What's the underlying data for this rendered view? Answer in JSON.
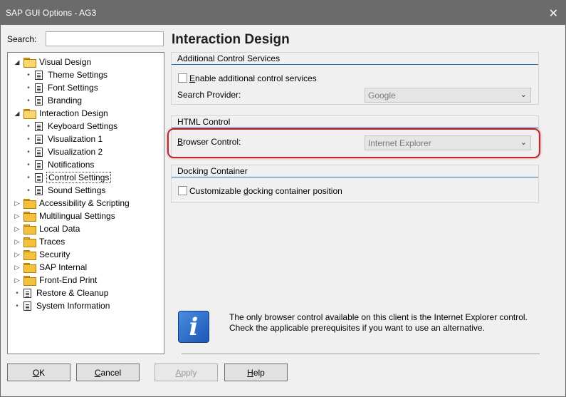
{
  "window": {
    "title": "SAP GUI Options - AG3"
  },
  "search": {
    "label": "Search:",
    "value": ""
  },
  "tree": [
    {
      "label": "Visual Design",
      "kind": "folder-open",
      "expander": "◢",
      "level": 0
    },
    {
      "label": "Theme Settings",
      "kind": "doc",
      "level": 1
    },
    {
      "label": "Font Settings",
      "kind": "doc",
      "level": 1
    },
    {
      "label": "Branding",
      "kind": "doc",
      "level": 1
    },
    {
      "label": "Interaction Design",
      "kind": "folder-open",
      "expander": "◢",
      "level": 0
    },
    {
      "label": "Keyboard Settings",
      "kind": "doc",
      "level": 1
    },
    {
      "label": "Visualization 1",
      "kind": "doc",
      "level": 1
    },
    {
      "label": "Visualization 2",
      "kind": "doc",
      "level": 1
    },
    {
      "label": "Notifications",
      "kind": "doc",
      "level": 1
    },
    {
      "label": "Control Settings",
      "kind": "doc",
      "level": 1,
      "selected": true
    },
    {
      "label": "Sound Settings",
      "kind": "doc",
      "level": 1
    },
    {
      "label": "Accessibility & Scripting",
      "kind": "folder",
      "expander": "▷",
      "level": 0
    },
    {
      "label": "Multilingual Settings",
      "kind": "folder",
      "expander": "▷",
      "level": 0
    },
    {
      "label": "Local Data",
      "kind": "folder",
      "expander": "▷",
      "level": 0
    },
    {
      "label": "Traces",
      "kind": "folder",
      "expander": "▷",
      "level": 0
    },
    {
      "label": "Security",
      "kind": "folder",
      "expander": "▷",
      "level": 0
    },
    {
      "label": "SAP Internal",
      "kind": "folder",
      "expander": "▷",
      "level": 0
    },
    {
      "label": "Front-End Print",
      "kind": "folder",
      "expander": "▷",
      "level": 0
    },
    {
      "label": "Restore & Cleanup",
      "kind": "doc",
      "level": 0
    },
    {
      "label": "System Information",
      "kind": "doc",
      "level": 0
    }
  ],
  "main": {
    "title": "Interaction Design",
    "additional": {
      "header": "Additional Control Services",
      "enable_pre": "E",
      "enable_post": "nable additional control services",
      "enable_checked": false,
      "provider_label": "Search Provider:",
      "provider_value": "Google"
    },
    "html": {
      "header": "HTML Control",
      "browser_pre": "B",
      "browser_post": "rowser Control:",
      "browser_value": "Internet Explorer"
    },
    "docking": {
      "header": "Docking Container",
      "custom_pre": "Customizable ",
      "custom_ul": "d",
      "custom_post": "ocking container position",
      "custom_checked": false
    },
    "info_text": "The only browser control available on this client is the Internet Explorer control. Check the applicable prerequisites if you want to use an alternative."
  },
  "buttons": {
    "ok_ul": "O",
    "ok_rest": "K",
    "cancel_ul": "C",
    "cancel_rest": "ancel",
    "apply_ul": "A",
    "apply_rest": "pply",
    "help_ul": "H",
    "help_rest": "elp"
  },
  "colors": {
    "titlebar": "#6b6b6b",
    "accent_rule": "#1f74b8",
    "highlight": "#c0272d"
  },
  "icons": {
    "info": "info-icon",
    "close": "close-icon"
  }
}
